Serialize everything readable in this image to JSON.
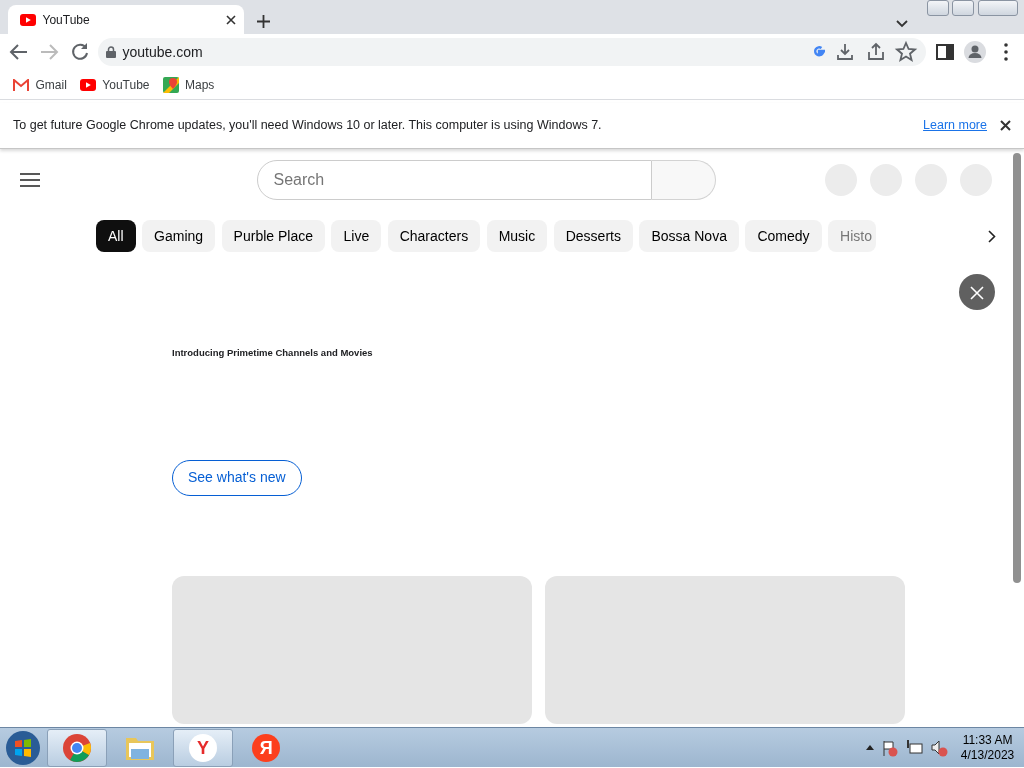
{
  "browser": {
    "tab": {
      "title": "YouTube",
      "selected": true
    },
    "address": "youtube.com",
    "bookmarks": [
      {
        "kind": "gmail",
        "label": "Gmail"
      },
      {
        "kind": "youtube",
        "label": "YouTube"
      },
      {
        "kind": "maps",
        "label": "Maps"
      }
    ]
  },
  "infobar": {
    "message": "To get future Google Chrome updates, you'll need Windows 10 or later. This computer is using Windows 7.",
    "link": "Learn more"
  },
  "youtube": {
    "search": {
      "placeholder": "Search"
    },
    "chips": [
      {
        "label": "All",
        "selected": true
      },
      {
        "label": "Gaming",
        "selected": false
      },
      {
        "label": "Purble Place",
        "selected": false
      },
      {
        "label": "Live",
        "selected": false
      },
      {
        "label": "Characters",
        "selected": false
      },
      {
        "label": "Music",
        "selected": false
      },
      {
        "label": "Desserts",
        "selected": false
      },
      {
        "label": "Bossa Nova",
        "selected": false
      },
      {
        "label": "Comedy",
        "selected": false
      },
      {
        "label": "Histo",
        "selected": false
      }
    ],
    "promo": {
      "title": "Introducing Primetime Channels and Movies",
      "button": "See what's new"
    }
  },
  "taskbar": {
    "apps": [
      {
        "kind": "chrome",
        "running": true
      },
      {
        "kind": "explorer",
        "running": false
      },
      {
        "kind": "yandex-browser",
        "glyph": "Y",
        "running": true
      },
      {
        "kind": "yandex",
        "glyph": "Я",
        "running": false
      }
    ],
    "time": "11:33 AM",
    "date": "4/13/2023"
  }
}
